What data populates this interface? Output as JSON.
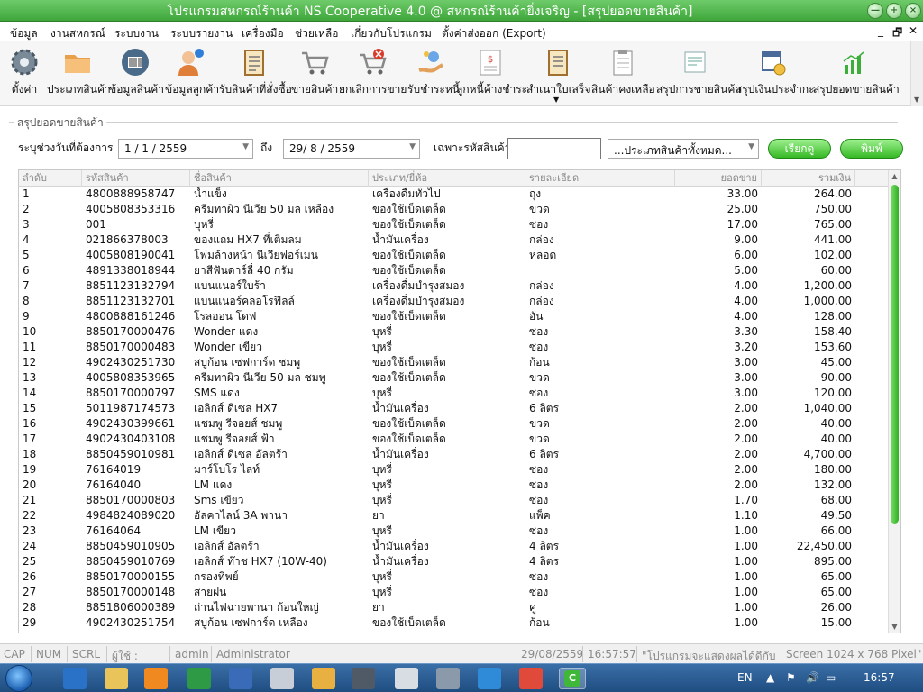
{
  "window": {
    "title": "โปรแกรมสหกรณ์ร้านค้า NS Cooperative 4.0 @ สหกรณ์ร้านค้ายิ่งเจริญ - [สรุปยอดขายสินค้า]",
    "minimize": "—",
    "maximize": "+",
    "close": "×"
  },
  "menu": {
    "items": [
      "ข้อมูล",
      "งานสหกรณ์",
      "ระบบงาน",
      "ระบบรายงาน",
      "เครื่องมือ",
      "ช่วยเหลือ",
      "เกี่ยวกับโปรแกรม",
      "ตั้งค่าส่งออก (Export)"
    ],
    "mdi_min": "_",
    "mdi_restore": "🗗",
    "mdi_close": "✕"
  },
  "toolbar": {
    "items": [
      {
        "label": "ตั้งค่า",
        "icon": "gear-icon"
      },
      {
        "label": "ประเภทสินค้า",
        "icon": "folder-icon"
      },
      {
        "label": "ข้อมูลสินค้า",
        "icon": "barcode-icon"
      },
      {
        "label": "ข้อมูลลูกค้า",
        "icon": "customer-icon"
      },
      {
        "label": "รับสินค้าที่สั่งซื้อ",
        "icon": "clipboard-icon"
      },
      {
        "label": "ขายสินค้า",
        "icon": "cart-icon"
      },
      {
        "label": "ยกเลิกการขาย",
        "icon": "cancel-cart-icon"
      },
      {
        "label": "รับชำระหนี้",
        "icon": "payment-icon"
      },
      {
        "label": "ลูกหนี้ค้างชำระ",
        "icon": "debtor-icon"
      },
      {
        "label": "สำเนาใบเสร็จ",
        "icon": "receipt-icon"
      },
      {
        "label": "สินค้าคงเหลือ",
        "icon": "inventory-icon"
      },
      {
        "label": "สรุปการขายสินค้า",
        "icon": "sales-summary-icon"
      },
      {
        "label": "สรุปเงินประจำกะ",
        "icon": "calendar-clock-icon"
      },
      {
        "label": "สรุปยอดขายสินค้า",
        "icon": "bar-chart-icon"
      }
    ]
  },
  "filter": {
    "legend": "สรุปยอดขายสินค้า",
    "range_label": "ระบุช่วงวันที่ต้องการ",
    "date_from": "1 / 1 / 2559",
    "to_label": "ถึง",
    "date_to": "29/ 8 / 2559",
    "code_label": "เฉพาะรหัสสินค้า",
    "code_value": "",
    "category_select": "...ประเภทสินค้าทั้งหมด...",
    "search_button": "เรียกดู",
    "print_button": "พิมพ์"
  },
  "table": {
    "headers": [
      "ลำดับ",
      "รหัสสินค้า",
      "ชื่อสินค้า",
      "ประเภท/ยี่ห้อ",
      "รายละเอียด",
      "ยอดขาย",
      "รวมเงิน"
    ],
    "rows": [
      [
        "1",
        "4800888958747",
        "น้ำแข็ง",
        "เครื่องดื่มทั่วไป",
        "ถุง",
        "33.00",
        "264.00"
      ],
      [
        "2",
        "4005808353316",
        "ครีมทาผิว นีเวีย 50 มล เหลือง",
        "ของใช้เบ็ดเตล็ด",
        "ขวด",
        "25.00",
        "750.00"
      ],
      [
        "3",
        "001",
        "บุหรี่",
        "ของใช้เบ็ดเตล็ด",
        "ซอง",
        "17.00",
        "765.00"
      ],
      [
        "4",
        "021866378003",
        "ของแถม HX7 ที่เติมลม",
        "น้ำมันเครื่อง",
        "กล่อง",
        "9.00",
        "441.00"
      ],
      [
        "5",
        "4005808190041",
        "โฟมล้างหน้า นีเวียฟอร์เมน",
        "ของใช้เบ็ดเตล็ด",
        "หลอด",
        "6.00",
        "102.00"
      ],
      [
        "6",
        "4891338018944",
        "ยาสีฟันดาร์ลี่ 40 กรัม",
        "ของใช้เบ็ดเตล็ด",
        "",
        "5.00",
        "60.00"
      ],
      [
        "7",
        "8851123132794",
        "แบนแนอร์ใบร้า",
        "เครื่องดื่มบำรุงสมอง",
        "กล่อง",
        "4.00",
        "1,200.00"
      ],
      [
        "8",
        "8851123132701",
        "แบนแนอร์คลอโรฟิลล์",
        "เครื่องดื่มบำรุงสมอง",
        "กล่อง",
        "4.00",
        "1,000.00"
      ],
      [
        "9",
        "4800888161246",
        "โรลออน โดฟ",
        "ของใช้เบ็ดเตล็ด",
        "อัน",
        "4.00",
        "128.00"
      ],
      [
        "10",
        "8850170000476",
        "Wonder แดง",
        "บุหรี่",
        "ซอง",
        "3.30",
        "158.40"
      ],
      [
        "11",
        "8850170000483",
        "Wonder เขียว",
        "บุหรี่",
        "ซอง",
        "3.20",
        "153.60"
      ],
      [
        "12",
        "4902430251730",
        "สบู่ก้อน เซฟการ์ด ชมพู",
        "ของใช้เบ็ดเตล็ด",
        "ก้อน",
        "3.00",
        "45.00"
      ],
      [
        "13",
        "4005808353965",
        "ครีมทาผิว นีเวีย 50 มล ชมพู",
        "ของใช้เบ็ดเตล็ด",
        "ขวด",
        "3.00",
        "90.00"
      ],
      [
        "14",
        "8850170000797",
        "SMS แดง",
        "บุหรี่",
        "ซอง",
        "3.00",
        "120.00"
      ],
      [
        "15",
        "5011987174573",
        "เอลิกส์ ดีเซล HX7",
        "น้ำมันเครื่อง",
        "6 ลิตร",
        "2.00",
        "1,040.00"
      ],
      [
        "16",
        "4902430399661",
        "แชมพู รีจอยส์ ชมพู",
        "ของใช้เบ็ดเตล็ด",
        "ขวด",
        "2.00",
        "40.00"
      ],
      [
        "17",
        "4902430403108",
        "แชมพู รีจอยส์ ฟ้า",
        "ของใช้เบ็ดเตล็ด",
        "ขวด",
        "2.00",
        "40.00"
      ],
      [
        "18",
        "8850459010981",
        "เอลิกส์ ดีเซล อัลตร้า",
        "น้ำมันเครื่อง",
        "6 ลิตร",
        "2.00",
        "4,700.00"
      ],
      [
        "19",
        "76164019",
        "มาร์โบโร ไลท์",
        "บุหรี่",
        "ซอง",
        "2.00",
        "180.00"
      ],
      [
        "20",
        "76164040",
        "LM แดง",
        "บุหรี่",
        "ซอง",
        "2.00",
        "132.00"
      ],
      [
        "21",
        "8850170000803",
        "Sms เขียว",
        "บุหรี่",
        "ซอง",
        "1.70",
        "68.00"
      ],
      [
        "22",
        "4984824089020",
        "อัลคาไลน์ 3A พานา",
        "ยา",
        "แพ็ค",
        "1.10",
        "49.50"
      ],
      [
        "23",
        "76164064",
        "LM เขียว",
        "บุหรี่",
        "ซอง",
        "1.00",
        "66.00"
      ],
      [
        "24",
        "8850459010905",
        "เอลิกส์ อัลตร้า",
        "น้ำมันเครื่อง",
        "4 ลิตร",
        "1.00",
        "22,450.00"
      ],
      [
        "25",
        "8850459010769",
        "เอลิกส์ ท๊าช HX7 (10W-40)",
        "น้ำมันเครื่อง",
        "4 ลิตร",
        "1.00",
        "895.00"
      ],
      [
        "26",
        "8850170000155",
        "กรองทิพย์",
        "บุหรี่",
        "ซอง",
        "1.00",
        "65.00"
      ],
      [
        "27",
        "8850170000148",
        "สายฝน",
        "บุหรี่",
        "ซอง",
        "1.00",
        "65.00"
      ],
      [
        "28",
        "8851806000389",
        "ถ่านไฟฉายพานา ก้อนใหญ่",
        "ยา",
        "คู่",
        "1.00",
        "26.00"
      ],
      [
        "29",
        "4902430251754",
        "สบู่ก้อน เซฟการ์ด เหลือง",
        "ของใช้เบ็ดเตล็ด",
        "ก้อน",
        "1.00",
        "15.00"
      ]
    ]
  },
  "statusbar": {
    "cap": "CAP",
    "num": "NUM",
    "scrl": "SCRL",
    "user_label": "ผู้ใช้ :",
    "user_id": "admin",
    "user_name": "Administrator",
    "date": "29/08/2559",
    "time": "16:57:57",
    "message": "\"โปรแกรมจะแสดงผลได้ดีกับ",
    "screen": "Screen 1024 x 768 Pixel\""
  },
  "taskbar": {
    "lang": "EN",
    "clock": "16:57"
  },
  "colors": {
    "titlebar": "#3fa63a",
    "button_green": "#36b825",
    "taskbar": "#1f4d80"
  }
}
